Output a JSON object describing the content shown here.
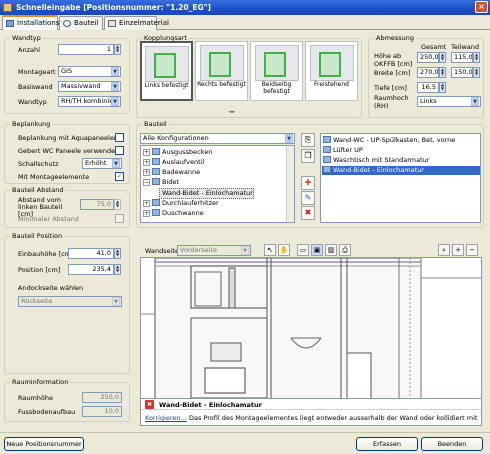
{
  "window": {
    "title": "Schnelleingabe [Positionsnummer: \"1.20_EG\"]",
    "close": "×"
  },
  "tabs": [
    {
      "label": "Installationswand",
      "active": true
    },
    {
      "label": "Bauteil",
      "active": false
    },
    {
      "label": "Einzelmaterial",
      "active": false
    }
  ],
  "wandtyp": {
    "title": "Wandtyp",
    "anzahl_label": "Anzahl",
    "anzahl_value": "1",
    "montageart_label": "Montageart",
    "montageart_value": "GIS",
    "basiswand_label": "Basiswand",
    "basiswand_value": "Massivwand",
    "wandtyp_label": "Wandtyp",
    "wandtyp_value": "RH/TH kombiniert"
  },
  "kopplungsart": {
    "title": "Kopplungsart",
    "options": [
      {
        "label": "Links befestigt",
        "selected": true
      },
      {
        "label": "Rechts befestigt",
        "selected": false
      },
      {
        "label": "Beidseitig befestigt",
        "selected": false
      },
      {
        "label": "Freistehend",
        "selected": false
      }
    ],
    "scroll_ticks": "◄►"
  },
  "abmessung": {
    "title": "Abmessung",
    "col_gesamt": "Gesamt",
    "col_teilwand": "Teilwand",
    "hoehe_label": "Höhe ab OKFFB [cm]",
    "hoehe_gesamt": "250,0",
    "hoehe_teilwand": "115,0",
    "breite_label": "Breite [cm]",
    "breite_gesamt": "270,0",
    "breite_teilwand": "150,0",
    "tiefe_label": "Tiefe [cm]",
    "tiefe_value": "16,5",
    "raumhoch_label": "Raumhoch (RH)",
    "raumhoch_value": "Links"
  },
  "beplankung": {
    "title": "Beplankung",
    "items": [
      {
        "label": "Beplankung mit Aquapaneelen",
        "checked": false
      },
      {
        "label": "Gebert WC Paneele verwenden",
        "checked": false
      }
    ],
    "schallschutz_label": "Schallschutz",
    "schallschutz_value": "Erhöht",
    "montageelemente_label": "Mit Montageelemente",
    "montageelemente_checked": true
  },
  "bauteil_abstand": {
    "title": "Bauteil Abstand",
    "abstand_label": "Abstand vom linken Bauteil [cm]",
    "abstand_value": "75,0",
    "minimaler_label": "Minimaler Abstand"
  },
  "bauteil": {
    "title": "Bauteil",
    "filter_value": "Alle Konfigurationen",
    "tree": [
      {
        "label": "Ausgussbecken",
        "indent": 0,
        "expander": "+"
      },
      {
        "label": "Auslaufventil",
        "indent": 0,
        "expander": "+"
      },
      {
        "label": "Badewanne",
        "indent": 0,
        "expander": "+"
      },
      {
        "label": "Bidet",
        "indent": 0,
        "expander": "−"
      },
      {
        "label": "Wand-Bidet - Einlochamatur",
        "indent": 1,
        "expander": ""
      },
      {
        "label": "Durchlauferhitzer",
        "indent": 0,
        "expander": "+"
      },
      {
        "label": "Duschwanne",
        "indent": 0,
        "expander": "+"
      }
    ],
    "selected_list": [
      "Wand-WC - UP-Spülkasten, Bet. vorne",
      "Lüfter UP",
      "Waschtisch mit Standarmatur",
      "Wand-Bidet - Einlochamatur"
    ]
  },
  "bauteil_position": {
    "title": "Bauteil Position",
    "einbauhoehe_label": "Einbauhöhe [cm]",
    "einbauhoehe_value": "41,0",
    "position_label": "Position [cm]",
    "position_value": "235,4",
    "andockseite_label": "Andockseite wählen",
    "andockseite_value": "Rückseite"
  },
  "rauminformation": {
    "title": "Rauminformation",
    "raumhoehe_label": "Raumhöhe",
    "raumhoehe_value": "250,0",
    "fussboden_label": "Fussbodenaufbau",
    "fussboden_value": "10,0"
  },
  "viewer": {
    "wandseite_label": "Wandseite",
    "wandseite_value": "Vorderseite"
  },
  "error": {
    "title": "Wand-Bidet - Einlochamatur",
    "link": "Korrigieren...",
    "message": "Das Profil des Montageelementes liegt entweder ausserhalb der Wand oder kollidiert mit einem Aussenprofil der Wand."
  },
  "footer": {
    "new_position": "Neue Positionsnummer",
    "erfassen": "Erfassen",
    "beenden": "Beenden"
  }
}
